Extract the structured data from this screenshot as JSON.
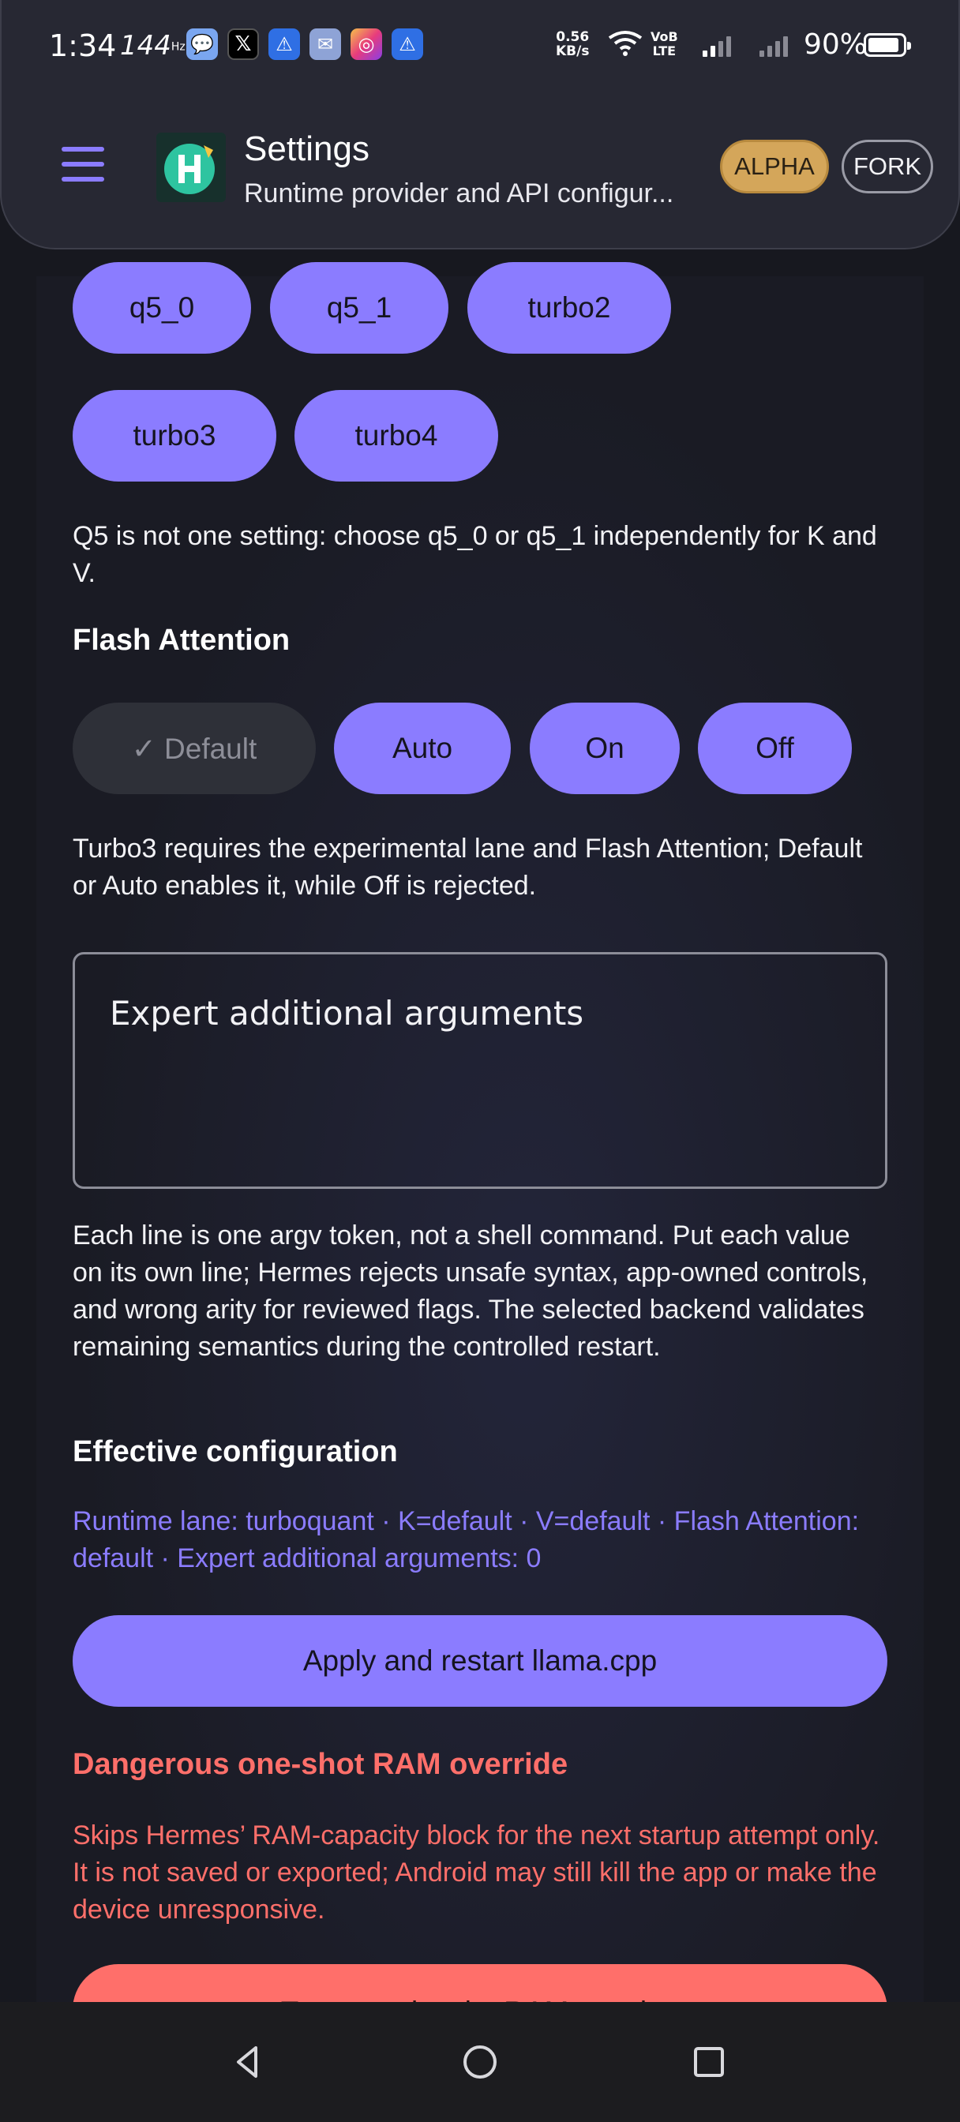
{
  "status_bar": {
    "time": "1:34",
    "refresh_rate": "144",
    "refresh_unit": "Hz",
    "net_speed_value": "0.56",
    "net_speed_unit": "KB/s",
    "volte_top": "VoB",
    "volte_bottom": "LTE",
    "battery": "90%",
    "notification_icons": [
      "chat-icon",
      "x-icon",
      "warning-icon",
      "mail-icon",
      "instagram-icon",
      "warning-icon"
    ]
  },
  "header": {
    "title": "Settings",
    "subtitle": "Runtime provider and API configur...",
    "badge_alpha": "ALPHA",
    "badge_fork": "FORK",
    "logo_icon": "hermes-logo-icon"
  },
  "kv_quant": {
    "options_row1": [
      "q5_0",
      "q5_1",
      "turbo2"
    ],
    "options_row2": [
      "turbo3",
      "turbo4"
    ],
    "note": "Q5 is not one setting: choose q5_0 or q5_1 independently for K and V."
  },
  "flash_attention": {
    "title": "Flash Attention",
    "options": [
      "✓ Default",
      "Auto",
      "On",
      "Off"
    ],
    "selected": "Default",
    "note": "Turbo3 requires the experimental lane and Flash Attention; Default or Auto enables it, while Off is rejected."
  },
  "expert_args": {
    "label": "Expert additional arguments",
    "value": "",
    "help": "Each line is one argv token, not a shell command. Put each value on its own line; Hermes rejects unsafe syntax, app-owned controls, and wrong arity for reviewed flags. The selected backend validates remaining semantics during the controlled restart."
  },
  "effective_config": {
    "title": "Effective configuration",
    "summary": "Runtime lane: turboquant · K=default · V=default · Flash Attention: default · Expert additional arguments: 0"
  },
  "actions": {
    "apply_label": "Apply and restart llama.cpp"
  },
  "danger": {
    "title": "Dangerous one-shot RAM override",
    "text": "Skips Hermes’ RAM-capacity block for the next startup attempt only. It is not saved or exported; Android may still kill the app or make the device unresponsive.",
    "button_label": "Try once despite RAM warning"
  },
  "colors": {
    "accent": "#8b7cff",
    "danger": "#ff6f6a",
    "badge_alpha": "#d4a65a",
    "background": "#17181f"
  }
}
